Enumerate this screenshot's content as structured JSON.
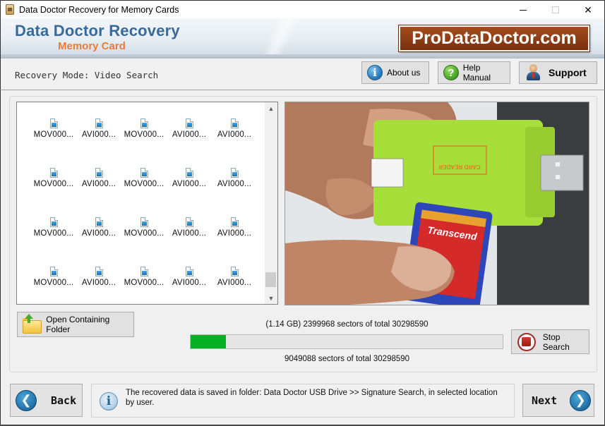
{
  "window": {
    "title": "Data Doctor Recovery for Memory Cards",
    "controls": [
      "minimize",
      "maximize",
      "close"
    ],
    "close_glyph": "✕"
  },
  "banner": {
    "title": "Data Doctor Recovery",
    "subtitle": "Memory Card",
    "logo": "ProDataDoctor.com"
  },
  "mode": {
    "text": "Recovery Mode: Video Search"
  },
  "toolbar": {
    "about_label": "About us",
    "about_icon_glyph": "i",
    "help_label": "Help Manual",
    "help_icon_glyph": "?",
    "support_label": "Support"
  },
  "file_list": {
    "items": [
      {
        "name": "MOV000..."
      },
      {
        "name": "AVI000..."
      },
      {
        "name": "MOV000..."
      },
      {
        "name": "AVI000..."
      },
      {
        "name": "AVI000..."
      },
      {
        "name": "MOV000..."
      },
      {
        "name": "AVI000..."
      },
      {
        "name": "MOV000..."
      },
      {
        "name": "AVI000..."
      },
      {
        "name": "AVI000..."
      },
      {
        "name": "MOV000..."
      },
      {
        "name": "AVI000..."
      },
      {
        "name": "MOV000..."
      },
      {
        "name": "AVI000..."
      },
      {
        "name": "AVI000..."
      },
      {
        "name": "MOV000..."
      },
      {
        "name": "AVI000..."
      },
      {
        "name": "MOV000..."
      },
      {
        "name": "AVI000..."
      },
      {
        "name": "AVI000..."
      }
    ],
    "scroll_up_glyph": "▲",
    "scroll_down_glyph": "▼"
  },
  "photo": {
    "description": "Hand inserting Transcend SDHC card into green USB card reader",
    "card_brand": "Transcend",
    "reader_label": "CARD READER"
  },
  "actions": {
    "open_folder_label": "Open Containing Folder",
    "stop_label": "Stop Search"
  },
  "progress": {
    "line1": "(1.14 GB) 2399968  sectors  of  total 30298590",
    "line2": "9049088  sectors  of  total 30298590",
    "fraction": 0.113,
    "color": "#06b025"
  },
  "footer": {
    "back_label": "Back",
    "back_glyph": "❮",
    "next_label": "Next",
    "next_glyph": "❯",
    "info_glyph": "i",
    "info_text": "The recovered data is saved in folder: Data Doctor USB Drive  >> Signature Search, in selected location by user."
  }
}
